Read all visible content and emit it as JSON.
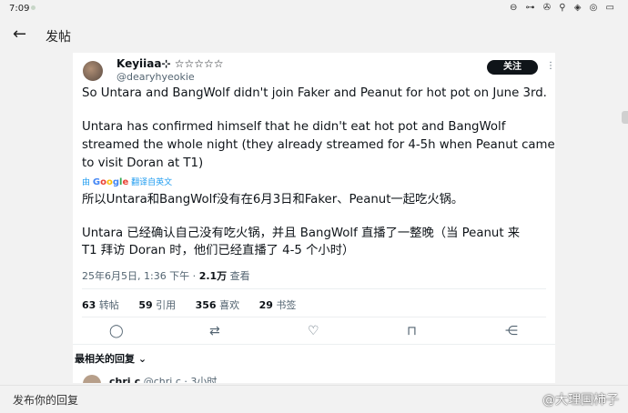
{
  "status_bar": {
    "time": "7:09",
    "icons": "⊖ ⊶ ✇ ⚲ ◈ ◎ ▭"
  },
  "header": {
    "back_icon": "←",
    "title": "发帖"
  },
  "tweet": {
    "display_name": "Keyiiaa⊹ ☆☆☆☆☆",
    "handle": "@dearyhyeokie",
    "follow_label": "关注",
    "more_icon": "⋮",
    "text_lines": [
      "So Untara and BangWolf didn't join Faker and Peanut for hot pot on June 3rd.",
      "Untara has confirmed himself that he didn't eat hot pot and BangWolf",
      "streamed the whole night (they already streamed for 4-5h when Peanut came",
      "to visit Doran at T1)"
    ],
    "translate": {
      "prefix": "由",
      "brand": "Google",
      "suffix": "翻译自英文"
    },
    "translated_lines": [
      "所以Untara和BangWolf没有在6月3日和Faker、Peanut一起吃火锅。",
      "Untara 已经确认自己没有吃火锅，并且 BangWolf 直播了一整晚（当 Peanut 来",
      "T1 拜访 Doran 时，他们已经直播了 4-5 个小时）"
    ],
    "meta": {
      "datetime": "25年6月5日, 1:36 下午 · ",
      "views": "2.1万",
      "views_label": " 查看"
    },
    "stats": [
      {
        "count": "63",
        "label": "转帖"
      },
      {
        "count": "59",
        "label": "引用"
      },
      {
        "count": "356",
        "label": "喜欢"
      },
      {
        "count": "29",
        "label": "书签"
      }
    ],
    "actions": {
      "reply": "◯",
      "retweet": "⇄",
      "like": "♡",
      "bookmark": "⊓",
      "share": "⋲"
    }
  },
  "replies": {
    "sort_label": "最相关的回复 ⌄",
    "first": {
      "name": "chri.c",
      "handle": "@chri.c · 3小时"
    }
  },
  "reply_bar": {
    "placeholder": "发布你的回复"
  },
  "watermark": "@大理国柿子"
}
